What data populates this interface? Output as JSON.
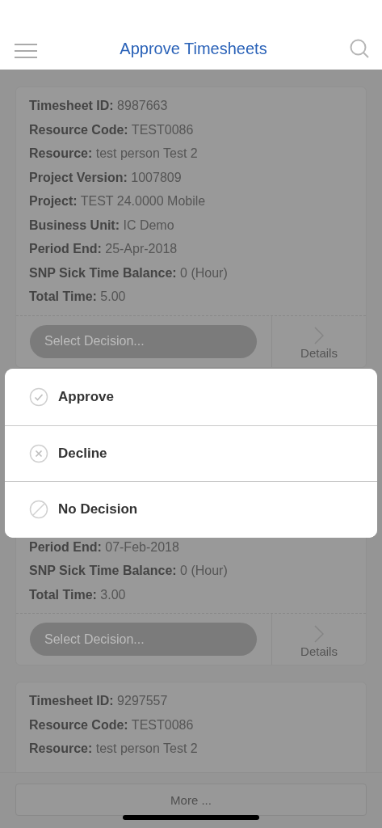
{
  "header": {
    "title": "Approve Timesheets"
  },
  "timesheets": [
    {
      "kind": "full",
      "fields": [
        {
          "label": "Timesheet ID:",
          "value": "8987663"
        },
        {
          "label": "Resource Code:",
          "value": "TEST0086"
        },
        {
          "label": "Resource:",
          "value": "test person Test 2"
        },
        {
          "label": "Project Version:",
          "value": "1007809"
        },
        {
          "label": "Project:",
          "value": "TEST 24.0000 Mobile"
        },
        {
          "label": "Business Unit:",
          "value": "IC Demo"
        },
        {
          "label": "Period End:",
          "value": "25-Apr-2018"
        },
        {
          "label": "SNP Sick Time Balance:",
          "value": "0 (Hour)"
        },
        {
          "label": "Total Time:",
          "value": "5.00"
        }
      ],
      "decision_placeholder": "Select Decision...",
      "details_label": "Details"
    },
    {
      "kind": "covered",
      "fields": [
        {
          "label": "Period End:",
          "value": "07-Feb-2018"
        },
        {
          "label": "SNP Sick Time Balance:",
          "value": "0 (Hour)"
        },
        {
          "label": "Total Time:",
          "value": "3.00"
        }
      ],
      "decision_placeholder": "Select Decision...",
      "details_label": "Details"
    },
    {
      "kind": "cut",
      "fields": [
        {
          "label": "Timesheet ID:",
          "value": "9297557"
        },
        {
          "label": "Resource Code:",
          "value": "TEST0086"
        },
        {
          "label": "Resource:",
          "value": "test person Test 2"
        }
      ]
    }
  ],
  "decision_menu": [
    {
      "kind": "approve",
      "label": "Approve"
    },
    {
      "kind": "decline",
      "label": "Decline"
    },
    {
      "kind": "none",
      "label": "No Decision"
    }
  ],
  "more_button": "More ..."
}
